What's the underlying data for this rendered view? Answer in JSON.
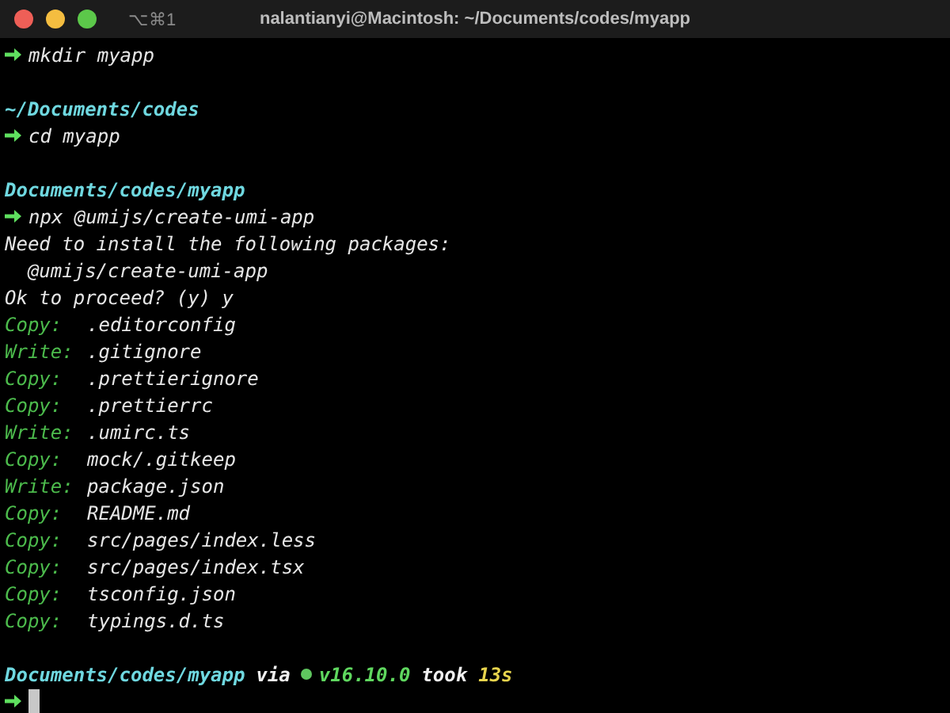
{
  "window": {
    "title": "nalantianyi@Macintosh: ~/Documents/codes/myapp",
    "shortcut": "⌥⌘1"
  },
  "lines": [
    {
      "kind": "command",
      "text": "mkdir myapp"
    },
    {
      "kind": "blank"
    },
    {
      "kind": "path",
      "text": "~/Documents/codes"
    },
    {
      "kind": "command",
      "text": "cd myapp"
    },
    {
      "kind": "blank"
    },
    {
      "kind": "path",
      "text": "Documents/codes/myapp"
    },
    {
      "kind": "command",
      "text": "npx @umijs/create-umi-app"
    },
    {
      "kind": "output",
      "text": "Need to install the following packages:"
    },
    {
      "kind": "output",
      "text": "  @umijs/create-umi-app"
    },
    {
      "kind": "output",
      "text": "Ok to proceed? (y) y"
    },
    {
      "kind": "file",
      "action": "Copy:",
      "path": ".editorconfig"
    },
    {
      "kind": "file",
      "action": "Write:",
      "path": ".gitignore"
    },
    {
      "kind": "file",
      "action": "Copy:",
      "path": ".prettierignore"
    },
    {
      "kind": "file",
      "action": "Copy:",
      "path": ".prettierrc"
    },
    {
      "kind": "file",
      "action": "Write:",
      "path": ".umirc.ts"
    },
    {
      "kind": "file",
      "action": "Copy:",
      "path": "mock/.gitkeep"
    },
    {
      "kind": "file",
      "action": "Write:",
      "path": "package.json"
    },
    {
      "kind": "file",
      "action": "Copy:",
      "path": "README.md"
    },
    {
      "kind": "file",
      "action": "Copy:",
      "path": "src/pages/index.less"
    },
    {
      "kind": "file",
      "action": "Copy:",
      "path": "src/pages/index.tsx"
    },
    {
      "kind": "file",
      "action": "Copy:",
      "path": "tsconfig.json"
    },
    {
      "kind": "file",
      "action": "Copy:",
      "path": "typings.d.ts"
    },
    {
      "kind": "blank"
    },
    {
      "kind": "status",
      "path": "Documents/codes/myapp",
      "via": "via",
      "version": "v16.10.0",
      "took": "took",
      "duration": "13s"
    },
    {
      "kind": "cursor"
    }
  ]
}
